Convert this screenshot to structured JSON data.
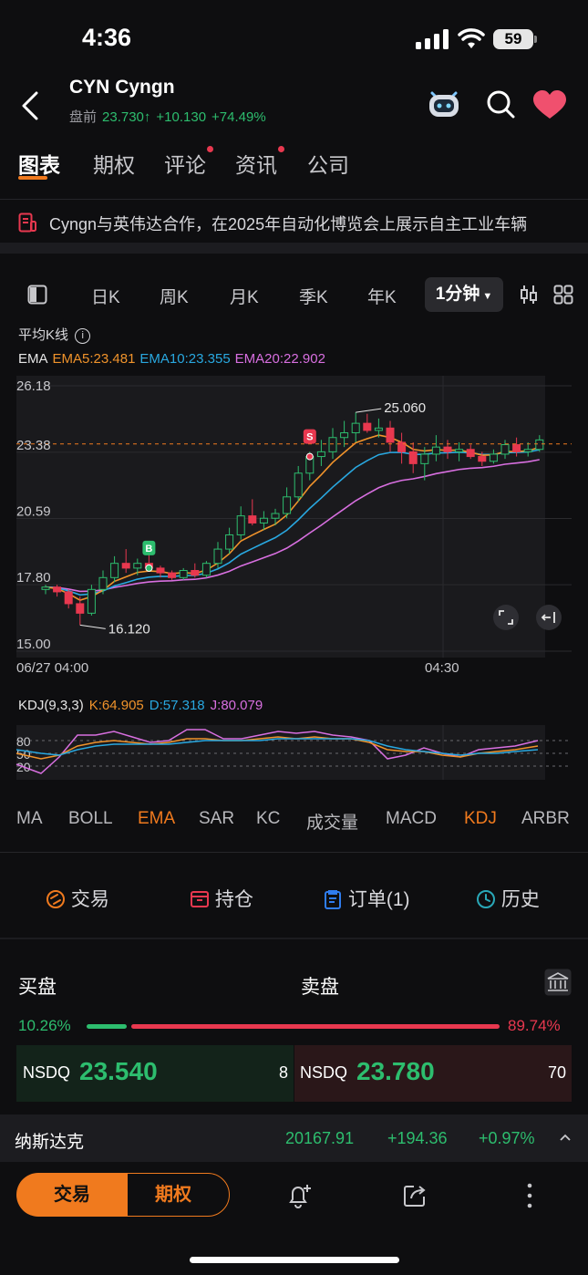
{
  "status_bar": {
    "time": "4:36",
    "battery": "59"
  },
  "header": {
    "symbol": "CYN",
    "name": "Cyngn",
    "session_label": "盘前",
    "price": "23.730",
    "change": "+10.130",
    "change_pct": "+74.49%"
  },
  "tabs": [
    {
      "label": "图表",
      "active": true,
      "dot": false
    },
    {
      "label": "期权",
      "active": false,
      "dot": false
    },
    {
      "label": "评论",
      "active": false,
      "dot": true
    },
    {
      "label": "资讯",
      "active": false,
      "dot": true
    },
    {
      "label": "公司",
      "active": false,
      "dot": false
    }
  ],
  "news_headline": "Cyngn与英伟达合作，在2025年自动化博览会上展示自主工业车辆",
  "periods": [
    "日K",
    "周K",
    "月K",
    "季K",
    "年K"
  ],
  "period_active": "1分钟",
  "avg_kline_label": "平均K线",
  "ema": {
    "label": "EMA",
    "ema5": "EMA5:23.481",
    "ema10": "EMA10:23.355",
    "ema20": "EMA20:22.902",
    "colors": {
      "ema5": "#f0932b",
      "ema10": "#29a8e0",
      "ema20": "#d86fe0"
    }
  },
  "chart_data": {
    "type": "candlestick",
    "y_ticks": [
      "26.18",
      "23.38",
      "20.59",
      "17.80",
      "15.00"
    ],
    "ylim": [
      15.0,
      26.18
    ],
    "x_ticks": [
      "06/27 04:00",
      "04:30"
    ],
    "high_label": "25.060",
    "low_label": "16.120",
    "last_price": 23.73,
    "sell_marker": "S",
    "buy_marker": "B",
    "candles": [
      [
        17.6,
        17.8,
        17.4,
        17.7
      ],
      [
        17.7,
        17.8,
        17.3,
        17.5
      ],
      [
        17.5,
        17.6,
        16.8,
        17.0
      ],
      [
        17.0,
        17.3,
        16.1,
        16.6
      ],
      [
        16.6,
        17.8,
        16.5,
        17.6
      ],
      [
        17.6,
        18.4,
        17.4,
        18.1
      ],
      [
        18.1,
        19.0,
        17.9,
        18.7
      ],
      [
        18.7,
        19.3,
        18.3,
        18.5
      ],
      [
        18.5,
        18.9,
        18.2,
        18.7
      ],
      [
        18.7,
        19.1,
        18.4,
        18.5
      ],
      [
        18.5,
        18.6,
        18.1,
        18.3
      ],
      [
        18.3,
        18.4,
        18.0,
        18.1
      ],
      [
        18.1,
        18.5,
        18.0,
        18.4
      ],
      [
        18.4,
        18.7,
        18.1,
        18.2
      ],
      [
        18.2,
        18.8,
        18.1,
        18.7
      ],
      [
        18.7,
        19.6,
        18.5,
        19.3
      ],
      [
        19.3,
        20.2,
        19.1,
        19.9
      ],
      [
        19.9,
        21.1,
        19.7,
        20.7
      ],
      [
        20.7,
        21.4,
        20.3,
        20.4
      ],
      [
        20.4,
        20.9,
        20.1,
        20.6
      ],
      [
        20.6,
        21.0,
        20.3,
        20.8
      ],
      [
        20.8,
        21.9,
        20.6,
        21.5
      ],
      [
        21.5,
        22.8,
        21.3,
        22.5
      ],
      [
        22.5,
        23.4,
        22.2,
        23.2
      ],
      [
        23.2,
        23.9,
        22.8,
        23.4
      ],
      [
        23.4,
        24.4,
        23.1,
        24.0
      ],
      [
        24.0,
        24.7,
        23.6,
        24.2
      ],
      [
        24.2,
        25.06,
        23.8,
        24.6
      ],
      [
        24.6,
        25.0,
        24.2,
        24.3
      ],
      [
        24.3,
        24.8,
        24.0,
        24.4
      ],
      [
        24.4,
        24.7,
        23.4,
        23.8
      ],
      [
        23.8,
        24.2,
        22.9,
        23.4
      ],
      [
        23.4,
        23.8,
        22.5,
        22.9
      ],
      [
        22.9,
        23.6,
        22.2,
        23.3
      ],
      [
        23.3,
        24.1,
        23.0,
        23.6
      ],
      [
        23.6,
        23.9,
        23.1,
        23.4
      ],
      [
        23.4,
        23.8,
        23.0,
        23.5
      ],
      [
        23.5,
        23.7,
        23.1,
        23.2
      ],
      [
        23.2,
        23.4,
        22.8,
        23.0
      ],
      [
        23.0,
        23.5,
        22.9,
        23.3
      ],
      [
        23.3,
        23.9,
        23.1,
        23.7
      ],
      [
        23.7,
        24.0,
        23.2,
        23.4
      ],
      [
        23.4,
        23.8,
        23.2,
        23.5
      ],
      [
        23.5,
        24.1,
        23.4,
        23.9
      ]
    ]
  },
  "kdj": {
    "label": "KDJ(9,3,3)",
    "k": "K:64.905",
    "d": "D:57.318",
    "j": "J:80.079",
    "levels": [
      "80",
      "50",
      "20"
    ],
    "colors": {
      "k": "#f0932b",
      "d": "#29a8e0",
      "j": "#d86fe0"
    }
  },
  "indicators": [
    {
      "label": "MA",
      "active": false
    },
    {
      "label": "BOLL",
      "active": false
    },
    {
      "label": "EMA",
      "active": true
    },
    {
      "label": "SAR",
      "active": false
    },
    {
      "label": "KC",
      "active": false
    },
    {
      "label": "成交量",
      "active": false
    },
    {
      "label": "MACD",
      "active": false
    },
    {
      "label": "KDJ",
      "active": true
    },
    {
      "label": "ARBR",
      "active": false
    }
  ],
  "actions": [
    {
      "label": "交易",
      "icon": "trade-icon"
    },
    {
      "label": "持仓",
      "icon": "position-icon"
    },
    {
      "label": "订单(1)",
      "icon": "order-icon"
    },
    {
      "label": "历史",
      "icon": "history-icon"
    }
  ],
  "orderbook": {
    "bid_title": "买盘",
    "ask_title": "卖盘",
    "bid_pct": "10.26%",
    "ask_pct": "89.74%",
    "bid": {
      "exchange": "NSDQ",
      "price": "23.540",
      "qty": "8"
    },
    "ask": {
      "exchange": "NSDQ",
      "price": "23.780",
      "qty": "70"
    }
  },
  "index": {
    "name": "纳斯达克",
    "value": "20167.91",
    "change": "+194.36",
    "change_pct": "+0.97%"
  },
  "bottom_bar": {
    "trade_label": "交易",
    "options_label": "期权"
  }
}
